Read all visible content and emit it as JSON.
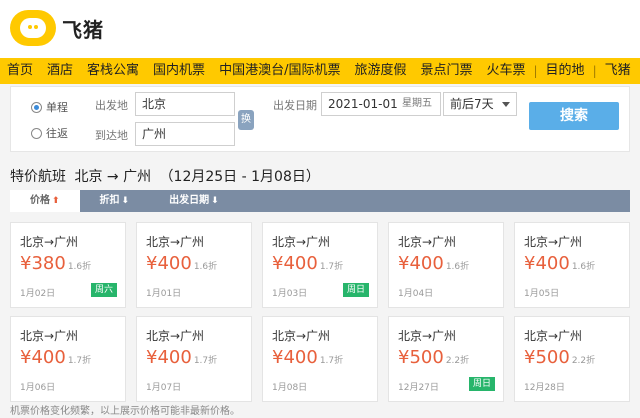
{
  "header": {
    "logo_text": "飞猪"
  },
  "nav": {
    "items": [
      "首页",
      "酒店",
      "客栈公寓",
      "国内机票",
      "中国港澳台/国际机票",
      "旅游度假",
      "景点门票",
      "火车票"
    ],
    "extra": [
      "目的地",
      "飞猪"
    ],
    "separator": "|"
  },
  "search": {
    "trip_type": {
      "one_way": "单程",
      "round_trip": "往返"
    },
    "from_label": "出发地",
    "from_value": "北京",
    "to_label": "到达地",
    "to_value": "广州",
    "swap_label": "换",
    "date_label": "出发日期",
    "date_value": "2021-01-01",
    "weekday": "星期五",
    "range_value": "前后7天",
    "search_button": "搜索"
  },
  "section": {
    "title": "特价航班",
    "route": "北京 → 广州",
    "range": "（12月25日 - 1月08日）"
  },
  "sort": {
    "tabs": [
      {
        "label": "价格",
        "arrow": "⬆"
      },
      {
        "label": "折扣",
        "arrow": "⬇"
      },
      {
        "label": "出发日期",
        "arrow": "⬇"
      }
    ]
  },
  "cards": [
    {
      "route": "北京→广州",
      "price": "¥380",
      "discount": "1.6折",
      "date": "1月02日",
      "badge": "周六"
    },
    {
      "route": "北京→广州",
      "price": "¥400",
      "discount": "1.6折",
      "date": "1月01日",
      "badge": ""
    },
    {
      "route": "北京→广州",
      "price": "¥400",
      "discount": "1.7折",
      "date": "1月03日",
      "badge": "周日"
    },
    {
      "route": "北京→广州",
      "price": "¥400",
      "discount": "1.6折",
      "date": "1月04日",
      "badge": ""
    },
    {
      "route": "北京→广州",
      "price": "¥400",
      "discount": "1.6折",
      "date": "1月05日",
      "badge": ""
    },
    {
      "route": "北京→广州",
      "price": "¥400",
      "discount": "1.7折",
      "date": "1月06日",
      "badge": ""
    },
    {
      "route": "北京→广州",
      "price": "¥400",
      "discount": "1.7折",
      "date": "1月07日",
      "badge": ""
    },
    {
      "route": "北京→广州",
      "price": "¥400",
      "discount": "1.7折",
      "date": "1月08日",
      "badge": ""
    },
    {
      "route": "北京→广州",
      "price": "¥500",
      "discount": "2.2折",
      "date": "12月27日",
      "badge": "周日"
    },
    {
      "route": "北京→广州",
      "price": "¥500",
      "discount": "2.2折",
      "date": "12月28日",
      "badge": ""
    }
  ],
  "footnote": "机票价格变化频繁，以上展示价格可能非最新价格。",
  "colors": {
    "brand": "#ffc900",
    "price": "#e8603c",
    "weekend": "#27b56b",
    "search_button": "#5aaee8"
  }
}
